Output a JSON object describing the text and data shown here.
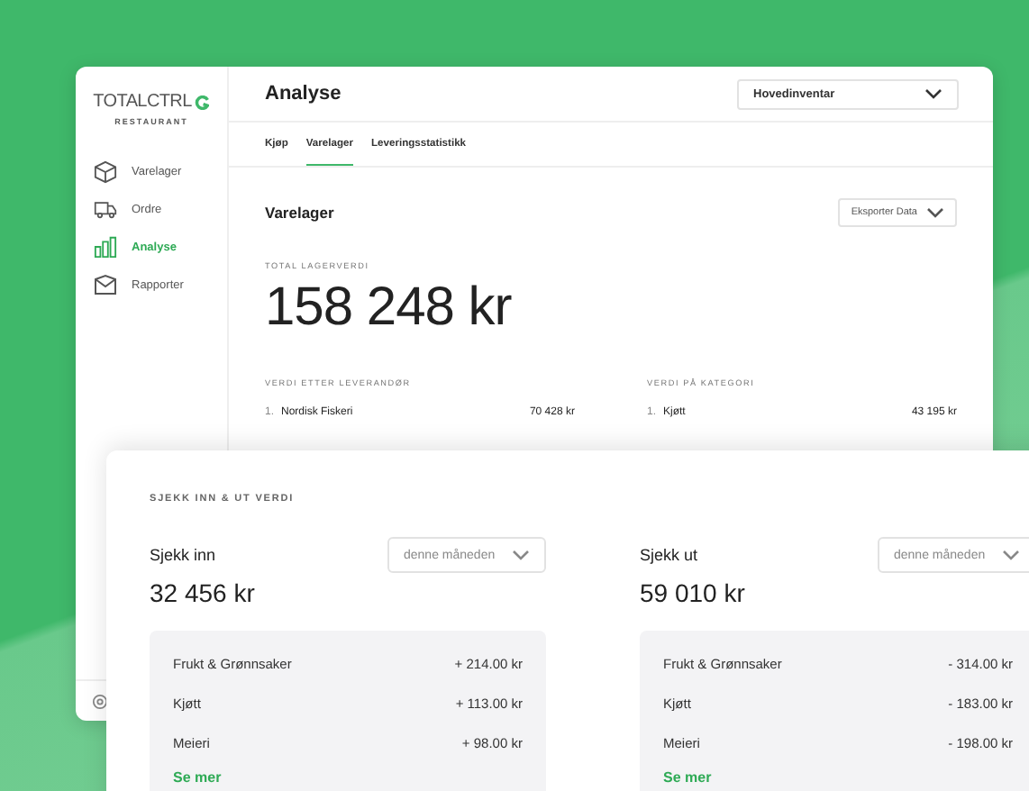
{
  "logo": {
    "brand": "TOTALCTRL",
    "subtitle": "RESTAURANT"
  },
  "sidebar": {
    "items": [
      {
        "label": "Varelager",
        "kind": "box",
        "selected": false
      },
      {
        "label": "Ordre",
        "kind": "truck",
        "selected": false
      },
      {
        "label": "Analyse",
        "kind": "chart",
        "selected": true
      },
      {
        "label": "Rapporter",
        "kind": "mail",
        "selected": false
      }
    ]
  },
  "header": {
    "title": "Analyse",
    "inventory_dropdown": "Hovedinventar"
  },
  "tabs": [
    {
      "label": "Kjøp",
      "selected": false
    },
    {
      "label": "Varelager",
      "selected": true
    },
    {
      "label": "Leveringsstatistikk",
      "selected": false
    }
  ],
  "section": {
    "title": "Varelager",
    "export_button": "Eksporter Data",
    "total_label": "TOTAL LAGERVERDI",
    "total_value": "158 248 kr"
  },
  "lists": [
    {
      "title": "VERDI ETTER LEVERANDØR",
      "rows": [
        {
          "rank": "1.",
          "name": "Nordisk Fiskeri",
          "value": "70 428 kr"
        }
      ]
    },
    {
      "title": "VERDI PÅ KATEGORI",
      "rows": [
        {
          "rank": "1.",
          "name": "Kjøtt",
          "value": "43 195 kr"
        }
      ]
    }
  ],
  "check_card": {
    "title": "SJEKK INN & UT VERDI",
    "columns": [
      {
        "label": "Sjekk inn",
        "period": "denne måneden",
        "total": "32 456 kr",
        "more_link": "Se mer",
        "rows": [
          {
            "name": "Frukt & Grønnsaker",
            "value": "+ 214.00 kr"
          },
          {
            "name": "Kjøtt",
            "value": "+ 113.00 kr"
          },
          {
            "name": "Meieri",
            "value": "+ 98.00 kr"
          }
        ]
      },
      {
        "label": "Sjekk ut",
        "period": "denne måneden",
        "total": "59 010 kr",
        "more_link": "Se mer",
        "rows": [
          {
            "name": "Frukt & Grønnsaker",
            "value": "- 314.00 kr"
          },
          {
            "name": "Kjøtt",
            "value": "- 183.00 kr"
          },
          {
            "name": "Meieri",
            "value": "- 198.00 kr"
          }
        ]
      }
    ]
  }
}
